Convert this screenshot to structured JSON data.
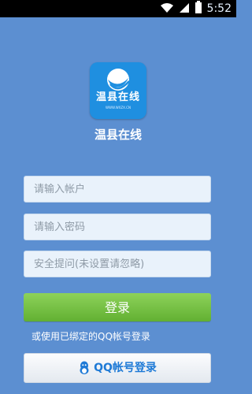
{
  "status_bar": {
    "time": "5:52",
    "icons": [
      "wifi-icon",
      "signal-icon",
      "battery-icon"
    ]
  },
  "logo": {
    "text": "温县在线",
    "url_text": "WWW.WXZX.CN"
  },
  "app": {
    "title": "温县在线"
  },
  "form": {
    "account_placeholder": "请输入帐户",
    "password_placeholder": "请输入密码",
    "security_placeholder": "安全提问(未设置请忽略)"
  },
  "actions": {
    "login_label": "登录",
    "alt_login_text": "或使用已绑定的QQ帐号登录",
    "qq_login_label": "QQ帐号登录"
  },
  "colors": {
    "background": "#5c8fd1",
    "field_bg": "#e9f2fb",
    "login_green": "#62b032",
    "qq_blue": "#1e7ad6",
    "logo_bg": "#1f8fe0"
  }
}
